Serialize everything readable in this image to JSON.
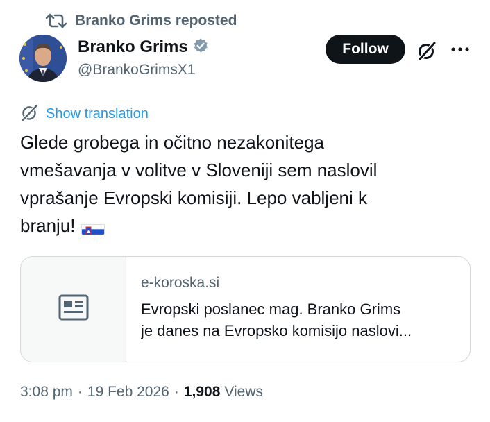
{
  "repost": {
    "text": "Branko Grims reposted",
    "icon": "repost-icon"
  },
  "author": {
    "display_name": "Branko Grims",
    "handle": "@BrankoGrimsX1",
    "verified": true,
    "verified_badge_color": "#829aab"
  },
  "actions": {
    "follow_label": "Follow",
    "grok_icon": "grok-icon",
    "more_icon": "more-icon"
  },
  "translate": {
    "label": "Show translation",
    "icon": "translate-icon"
  },
  "tweet": {
    "lines": [
      "Glede grobega in očitno nezakonitega",
      "vmešavanja v volitve v Sloveniji sem naslovil",
      "vprašanje Evropski komisiji. Lepo vabljeni k",
      "branju!"
    ],
    "emoji": "flag-slovenia"
  },
  "card": {
    "domain": "e-koroska.si",
    "desc_line1": "Evropski poslanec mag. Branko Grims",
    "desc_line2": "je danes na Evropsko komisijo naslovi...",
    "thumb_icon": "article-icon"
  },
  "meta": {
    "time": "3:08 pm",
    "date": "19 Feb 2026",
    "views_count": "1,908",
    "views_label": "Views"
  },
  "colors": {
    "text": "#0f1419",
    "secondary": "#536471",
    "link": "#1d9bf0",
    "border": "#cfd9de",
    "button": "#0f1419"
  }
}
